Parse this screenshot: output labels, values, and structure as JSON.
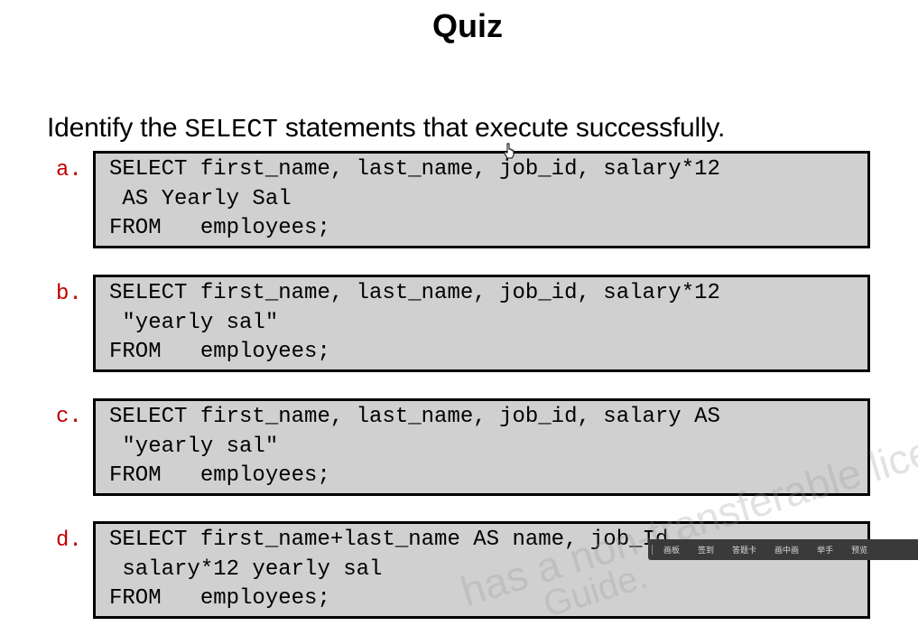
{
  "slide": {
    "title": "Quiz",
    "question_prefix": "Identify the ",
    "question_code": "SELECT",
    "question_suffix": " statements that execute successfully."
  },
  "options": [
    {
      "label": "a.",
      "lines": [
        "SELECT first_name, last_name, job_id, salary*12",
        " AS Yearly Sal",
        "FROM   employees;"
      ]
    },
    {
      "label": "b.",
      "lines": [
        "SELECT first_name, last_name, job_id, salary*12",
        " \"yearly sal\"",
        "FROM   employees;"
      ]
    },
    {
      "label": "c.",
      "lines": [
        "SELECT first_name, last_name, job_id, salary AS",
        " \"yearly sal\"",
        "FROM   employees;"
      ]
    },
    {
      "label": "d.",
      "lines": [
        "SELECT first_name+last_name AS name, job_Id",
        " salary*12 yearly sal",
        "FROM   employees;"
      ]
    }
  ],
  "watermark": {
    "line1": "has a non-transferable licen",
    "line2": "Guide."
  },
  "toolbar": {
    "items": [
      "画板",
      "签到",
      "答题卡",
      "画中画",
      "举手",
      "预览"
    ]
  },
  "icons": {
    "cursor": "hand-pointer-icon"
  }
}
